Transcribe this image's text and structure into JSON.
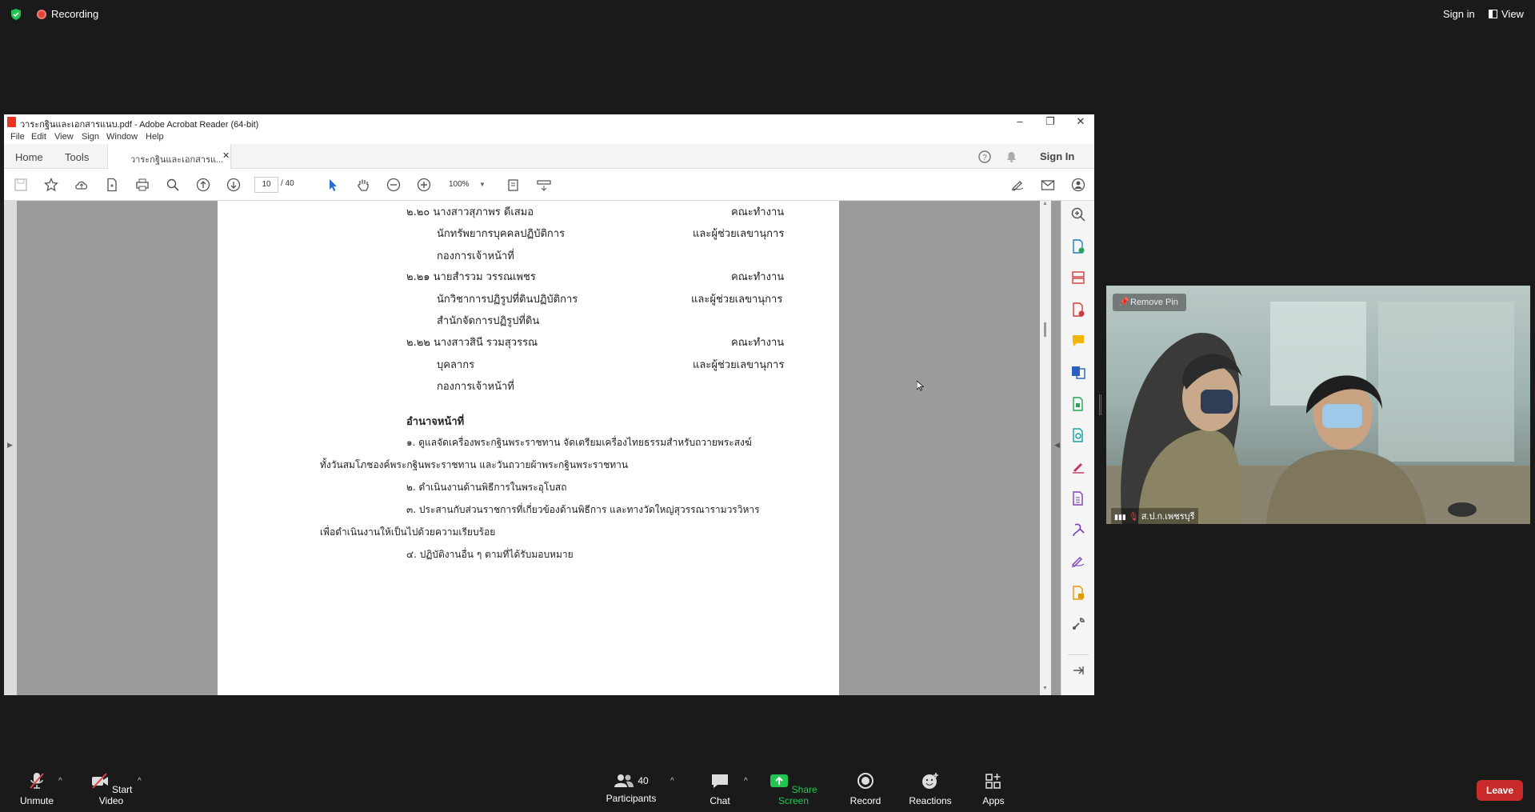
{
  "topbar": {
    "recording": "Recording",
    "signin": "Sign in",
    "view": "View"
  },
  "acrobat": {
    "title": "วาระกฐินและเอกสารแนบ.pdf - Adobe Acrobat Reader (64-bit)",
    "menu": [
      "File",
      "Edit",
      "View",
      "Sign",
      "Window",
      "Help"
    ],
    "tabs": {
      "home": "Home",
      "tools": "Tools",
      "doc": "วาระกฐินและเอกสารแ...",
      "signin": "Sign In"
    },
    "page_current": "10",
    "page_total": "/ 40",
    "zoom": "100%",
    "page_lines": [
      "๒.๒๐ นางสาวสุภาพร  ดีเสมอ",
      "คณะทำงาน",
      "นักทรัพยากรบุคคลปฏิบัติการ",
      "และผู้ช่วยเลขานุการ",
      "กองการเจ้าหน้าที่",
      "๒.๒๑ นายสำรวม  วรรณเพชร",
      "คณะทำงาน",
      "นักวิชาการปฏิรูปที่ดินปฏิบัติการ",
      "และผู้ช่วยเลขานุการ",
      "สำนักจัดการปฏิรูปที่ดิน",
      "๒.๒๒ นางสาวสินี  รวมสุวรรณ",
      "คณะทำงาน",
      "บุคลากร",
      "และผู้ช่วยเลขานุการ",
      "กองการเจ้าหน้าที่",
      "อำนาจหน้าที่",
      "๑. ดูแลจัดเครื่องพระกฐินพระราชทาน จัดเตรียมเครื่องไทยธรรมสำหรับถวายพระสงฆ์",
      "ทั้งวันสมโภชองค์พระกฐินพระราชทาน และวันถวายผ้าพระกฐินพระราชทาน",
      "๒. ดำเนินงานด้านพิธีการในพระอุโบสถ",
      "๓. ประสานกับส่วนราชการที่เกี่ยวข้องด้านพิธีการ และทางวัดใหญ่สุวรรณารามวรวิหาร",
      "เพื่อดำเนินงานให้เป็นไปด้วยความเรียบร้อย",
      "๔. ปฏิบัติงานอื่น ๆ ตามที่ได้รับมอบหมาย"
    ]
  },
  "video": {
    "remove_pin": "Remove Pin",
    "name": "ส.ป.ก.เพชรบุรี"
  },
  "bottombar": {
    "unmute": "Unmute",
    "start_video": "Start Video",
    "participants": "Participants",
    "participants_count": "40",
    "chat": "Chat",
    "share": "Share Screen",
    "record": "Record",
    "reactions": "Reactions",
    "apps": "Apps",
    "leave": "Leave"
  },
  "colors": {
    "share_green": "#23c552",
    "leave_red": "#c92a2a",
    "rec_red": "#e0443b"
  }
}
